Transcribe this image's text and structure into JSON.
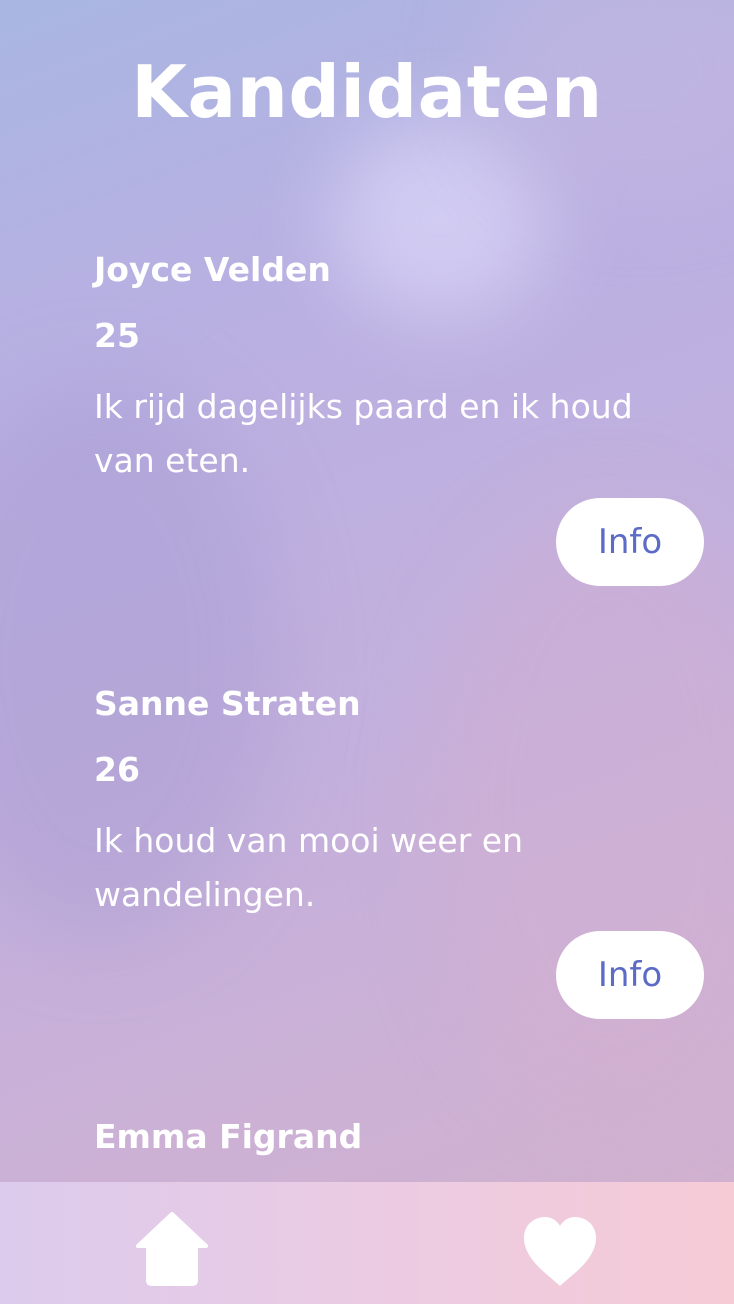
{
  "page": {
    "title": "Kandidaten"
  },
  "candidates": [
    {
      "name": "Joyce Velden",
      "age": "25",
      "description": "Ik rijd dagelijks paard en ik houd van eten.",
      "button_label": "Info"
    },
    {
      "name": "Sanne Straten",
      "age": "26",
      "description": "Ik houd van mooi weer en wandelingen.",
      "button_label": "Info"
    },
    {
      "name": "Emma Figrand"
    }
  ],
  "bottom_nav": {
    "items": [
      {
        "icon": "home-icon"
      },
      {
        "icon": "heart-icon"
      }
    ]
  },
  "colors": {
    "accent": "#5b6bc6",
    "text": "#ffffff",
    "button_bg": "#ffffff"
  }
}
